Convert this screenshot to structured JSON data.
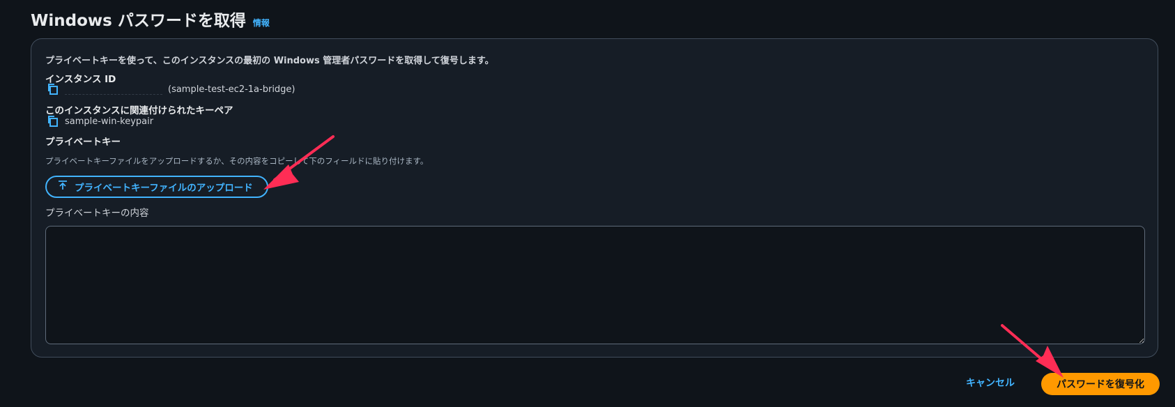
{
  "header": {
    "title": "Windows パスワードを取得",
    "info_link": "情報"
  },
  "panel": {
    "description": "プライベートキーを使って、このインスタンスの最初の Windows 管理者パスワードを取得して復号します。",
    "instance_id": {
      "label": "インスタンス ID",
      "name": "(sample-test-ec2-1a-bridge)"
    },
    "keypair": {
      "label": "このインスタンスに関連付けられたキーペア",
      "value": "sample-win-keypair"
    },
    "private_key": {
      "label": "プライベートキー",
      "hint": "プライベートキーファイルをアップロードするか、その内容をコピーして下のフィールドに貼り付けます。",
      "upload_button": "プライベートキーファイルのアップロード"
    },
    "key_contents": {
      "label": "プライベートキーの内容",
      "value": ""
    }
  },
  "footer": {
    "cancel_label": "キャンセル",
    "decrypt_label": "パスワードを復号化"
  },
  "colors": {
    "accent": "#42b4ff",
    "primary_button": "#ff9900",
    "annotation_arrow": "#ff2d55"
  },
  "icons": {
    "copy": "copy-icon",
    "upload": "upload-icon",
    "annotation": "arrow-annotation"
  }
}
